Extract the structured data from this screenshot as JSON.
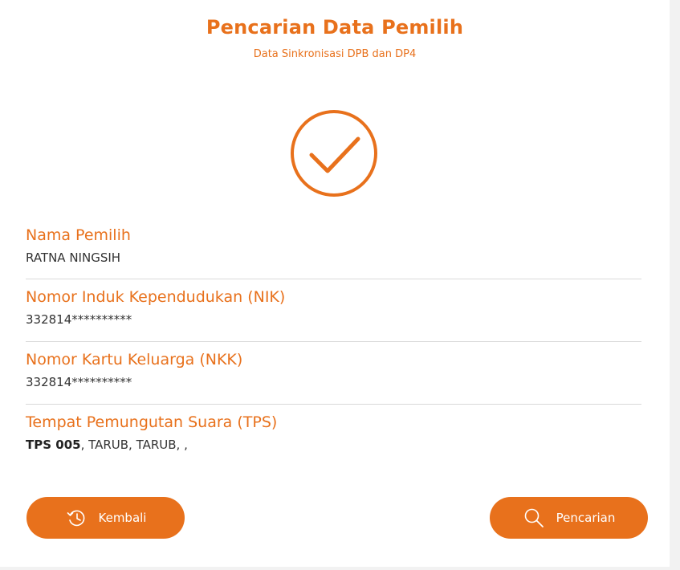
{
  "header": {
    "title": "Pencarian Data Pemilih",
    "subtitle": "Data Sinkronisasi DPB dan DP4"
  },
  "status_icon": "check-circle-icon",
  "fields": [
    {
      "label": "Nama Pemilih",
      "value": "RATNA NINGSIH"
    },
    {
      "label": "Nomor Induk Kependudukan (NIK)",
      "value": "332814**********"
    },
    {
      "label": "Nomor Kartu Keluarga (NKK)",
      "value": "332814**********"
    },
    {
      "label": "Tempat Pemungutan Suara (TPS)",
      "tps_code": "TPS 005",
      "value": ", TARUB, TARUB, ,"
    }
  ],
  "buttons": {
    "back": {
      "label": "Kembali",
      "icon": "history-icon"
    },
    "search": {
      "label": "Pencarian",
      "icon": "search-icon"
    }
  },
  "colors": {
    "accent": "#e8711c",
    "text": "#333333",
    "divider": "#d9d9d9"
  }
}
